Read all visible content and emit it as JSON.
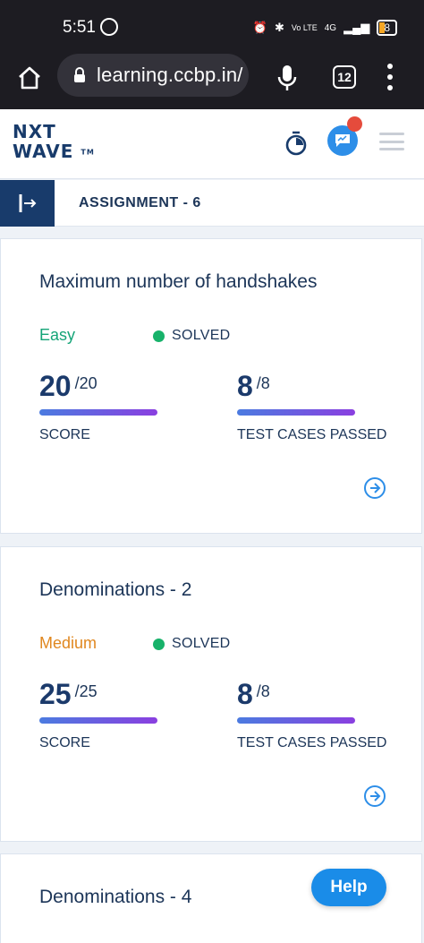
{
  "status_bar": {
    "time": "5:51",
    "signal_label": "4G",
    "volte_label": "Vo LTE",
    "battery": "8"
  },
  "browser": {
    "url": "learning.ccbp.in/",
    "tab_count": "12"
  },
  "header": {
    "logo_line1": "NXT",
    "logo_line2": "WAVE",
    "logo_tm": "TM"
  },
  "assignment": {
    "title": "ASSIGNMENT - 6"
  },
  "cards": [
    {
      "title": "Maximum number of handshakes",
      "difficulty": "Easy",
      "status": "SOLVED",
      "score": "20",
      "score_total": "/20",
      "score_label": "SCORE",
      "tests": "8",
      "tests_total": "/8",
      "tests_label": "TEST CASES PASSED"
    },
    {
      "title": "Denominations - 2",
      "difficulty": "Medium",
      "status": "SOLVED",
      "score": "25",
      "score_total": "/25",
      "score_label": "SCORE",
      "tests": "8",
      "tests_total": "/8",
      "tests_label": "TEST CASES PASSED"
    },
    {
      "title": "Denominations - 4"
    }
  ],
  "help_label": "Help",
  "colors": {
    "brand_navy": "#183b6b",
    "easy_green": "#14a477",
    "medium_orange": "#e0871f",
    "solved_dot": "#17b26a",
    "accent_blue": "#1a8ce8"
  },
  "icons": {
    "home": "home-icon",
    "lock": "lock-icon",
    "mic": "mic-icon",
    "menu": "more-vert-icon",
    "timer": "stopwatch-icon",
    "chat": "chat-icon",
    "hamburger": "hamburger-icon",
    "sidebar": "sidebar-expand-icon",
    "arrow": "arrow-right-circle-icon"
  }
}
